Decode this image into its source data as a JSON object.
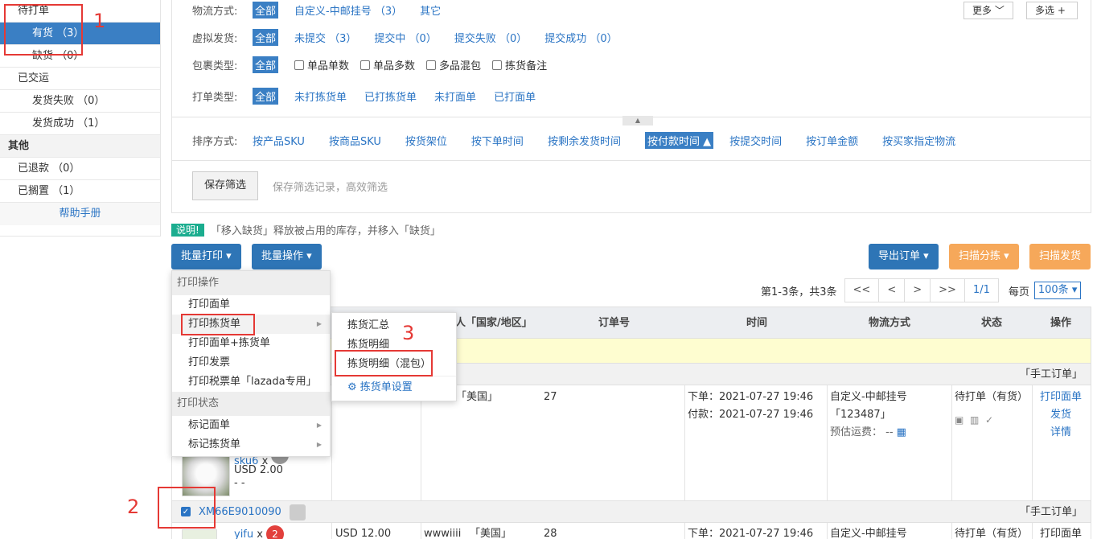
{
  "sidebar": {
    "items": [
      {
        "label": "待打单"
      },
      {
        "label": "有货 （3）"
      },
      {
        "label": "缺货 （0）"
      },
      {
        "label": "已交运"
      },
      {
        "label": "发货失败 （0）"
      },
      {
        "label": "发货成功 （1）"
      },
      {
        "label": "其他"
      },
      {
        "label": "已退款 （0）"
      },
      {
        "label": "已搁置 （1）"
      },
      {
        "label": "帮助手册"
      }
    ]
  },
  "filters": {
    "logistics": {
      "label": "物流方式:",
      "options": [
        "全部",
        "自定义-中邮挂号 （3）",
        "其它"
      ]
    },
    "virtual": {
      "label": "虚拟发货:",
      "options": [
        "全部",
        "未提交 （3）",
        "提交中 （0）",
        "提交失败 （0）",
        "提交成功 （0）"
      ]
    },
    "package": {
      "label": "包裹类型:",
      "options": [
        "全部",
        "单品单数",
        "单品多数",
        "多品混包",
        "拣货备注"
      ]
    },
    "print_type": {
      "label": "打单类型:",
      "options": [
        "全部",
        "未打拣货单",
        "已打拣货单",
        "未打面单",
        "已打面单"
      ]
    },
    "more_label": "更多",
    "multi_label": "多选 +",
    "sort": {
      "label": "排序方式:",
      "options": [
        "按产品SKU",
        "按商品SKU",
        "按货架位",
        "按下单时间",
        "按剩余发货时间",
        "按付款时间",
        "按提交时间",
        "按订单金额",
        "按买家指定物流"
      ]
    },
    "save_button": "保存筛选",
    "save_hint": "保存筛选记录，高效筛选"
  },
  "notice": {
    "badge": "说明!",
    "text": "「移入缺货」释放被占用的库存，并移入「缺货」"
  },
  "toolbar": {
    "batch_print": "批量打印",
    "batch_ops": "批量操作",
    "export": "导出订单",
    "scan_sort": "扫描分拣",
    "scan_ship": "扫描发货"
  },
  "pager": {
    "summary": "第1-3条，共3条",
    "first": "<<",
    "prev": "<",
    "next": ">",
    "last": ">>",
    "page": "1/1",
    "per_page_label": "每页",
    "per_page_value": "100条"
  },
  "table": {
    "headers": [
      "人「国家/地区」",
      "订单号",
      "时间",
      "物流方式",
      "状态",
      "操作"
    ],
    "group_tag": "「手工订单」",
    "row1": {
      "product_sku": "sku6",
      "qty_prefix": "x",
      "price": "USD 2.00",
      "dash": "- -",
      "country": "「美国」",
      "order_no": "27",
      "order_time": "下单：2021-07-27 19:46",
      "pay_time": "付款：2021-07-27 19:46",
      "logistics": "自定义-中邮挂号",
      "tracking": "「123487」",
      "fee": "预估运费： --",
      "status": "待打单（有货）",
      "ops": [
        "打印面单",
        "发货",
        "详情"
      ]
    },
    "row2": {
      "order_id": "XM66E9010090",
      "product_sku": "yifu",
      "qty_prefix": "x",
      "qty": "2",
      "price": "USD 12.00",
      "buyer": "wwwiiii",
      "country": "「美国」",
      "order_no": "28",
      "order_time": "下单：2021-07-27 19:46",
      "logistics": "自定义-中邮挂号",
      "status": "待打单（有货）",
      "op": "打印面单"
    }
  },
  "menu_print": {
    "section1": "打印操作",
    "items1": [
      "打印面单",
      "打印拣货单",
      "打印面单+拣货单",
      "打印发票",
      "打印税票单「lazada专用」"
    ],
    "section2": "打印状态",
    "items2": [
      "标记面单",
      "标记拣货单"
    ]
  },
  "menu_picklist": {
    "items": [
      "拣货汇总",
      "拣货明细",
      "拣货明细（混包）"
    ],
    "settings": "拣货单设置"
  },
  "annotations": {
    "n1": "1",
    "n2": "2",
    "n3": "3"
  },
  "colors": {
    "accent": "#3a7fc4",
    "orange": "#f6a85a",
    "annotation_red": "#e53935"
  }
}
